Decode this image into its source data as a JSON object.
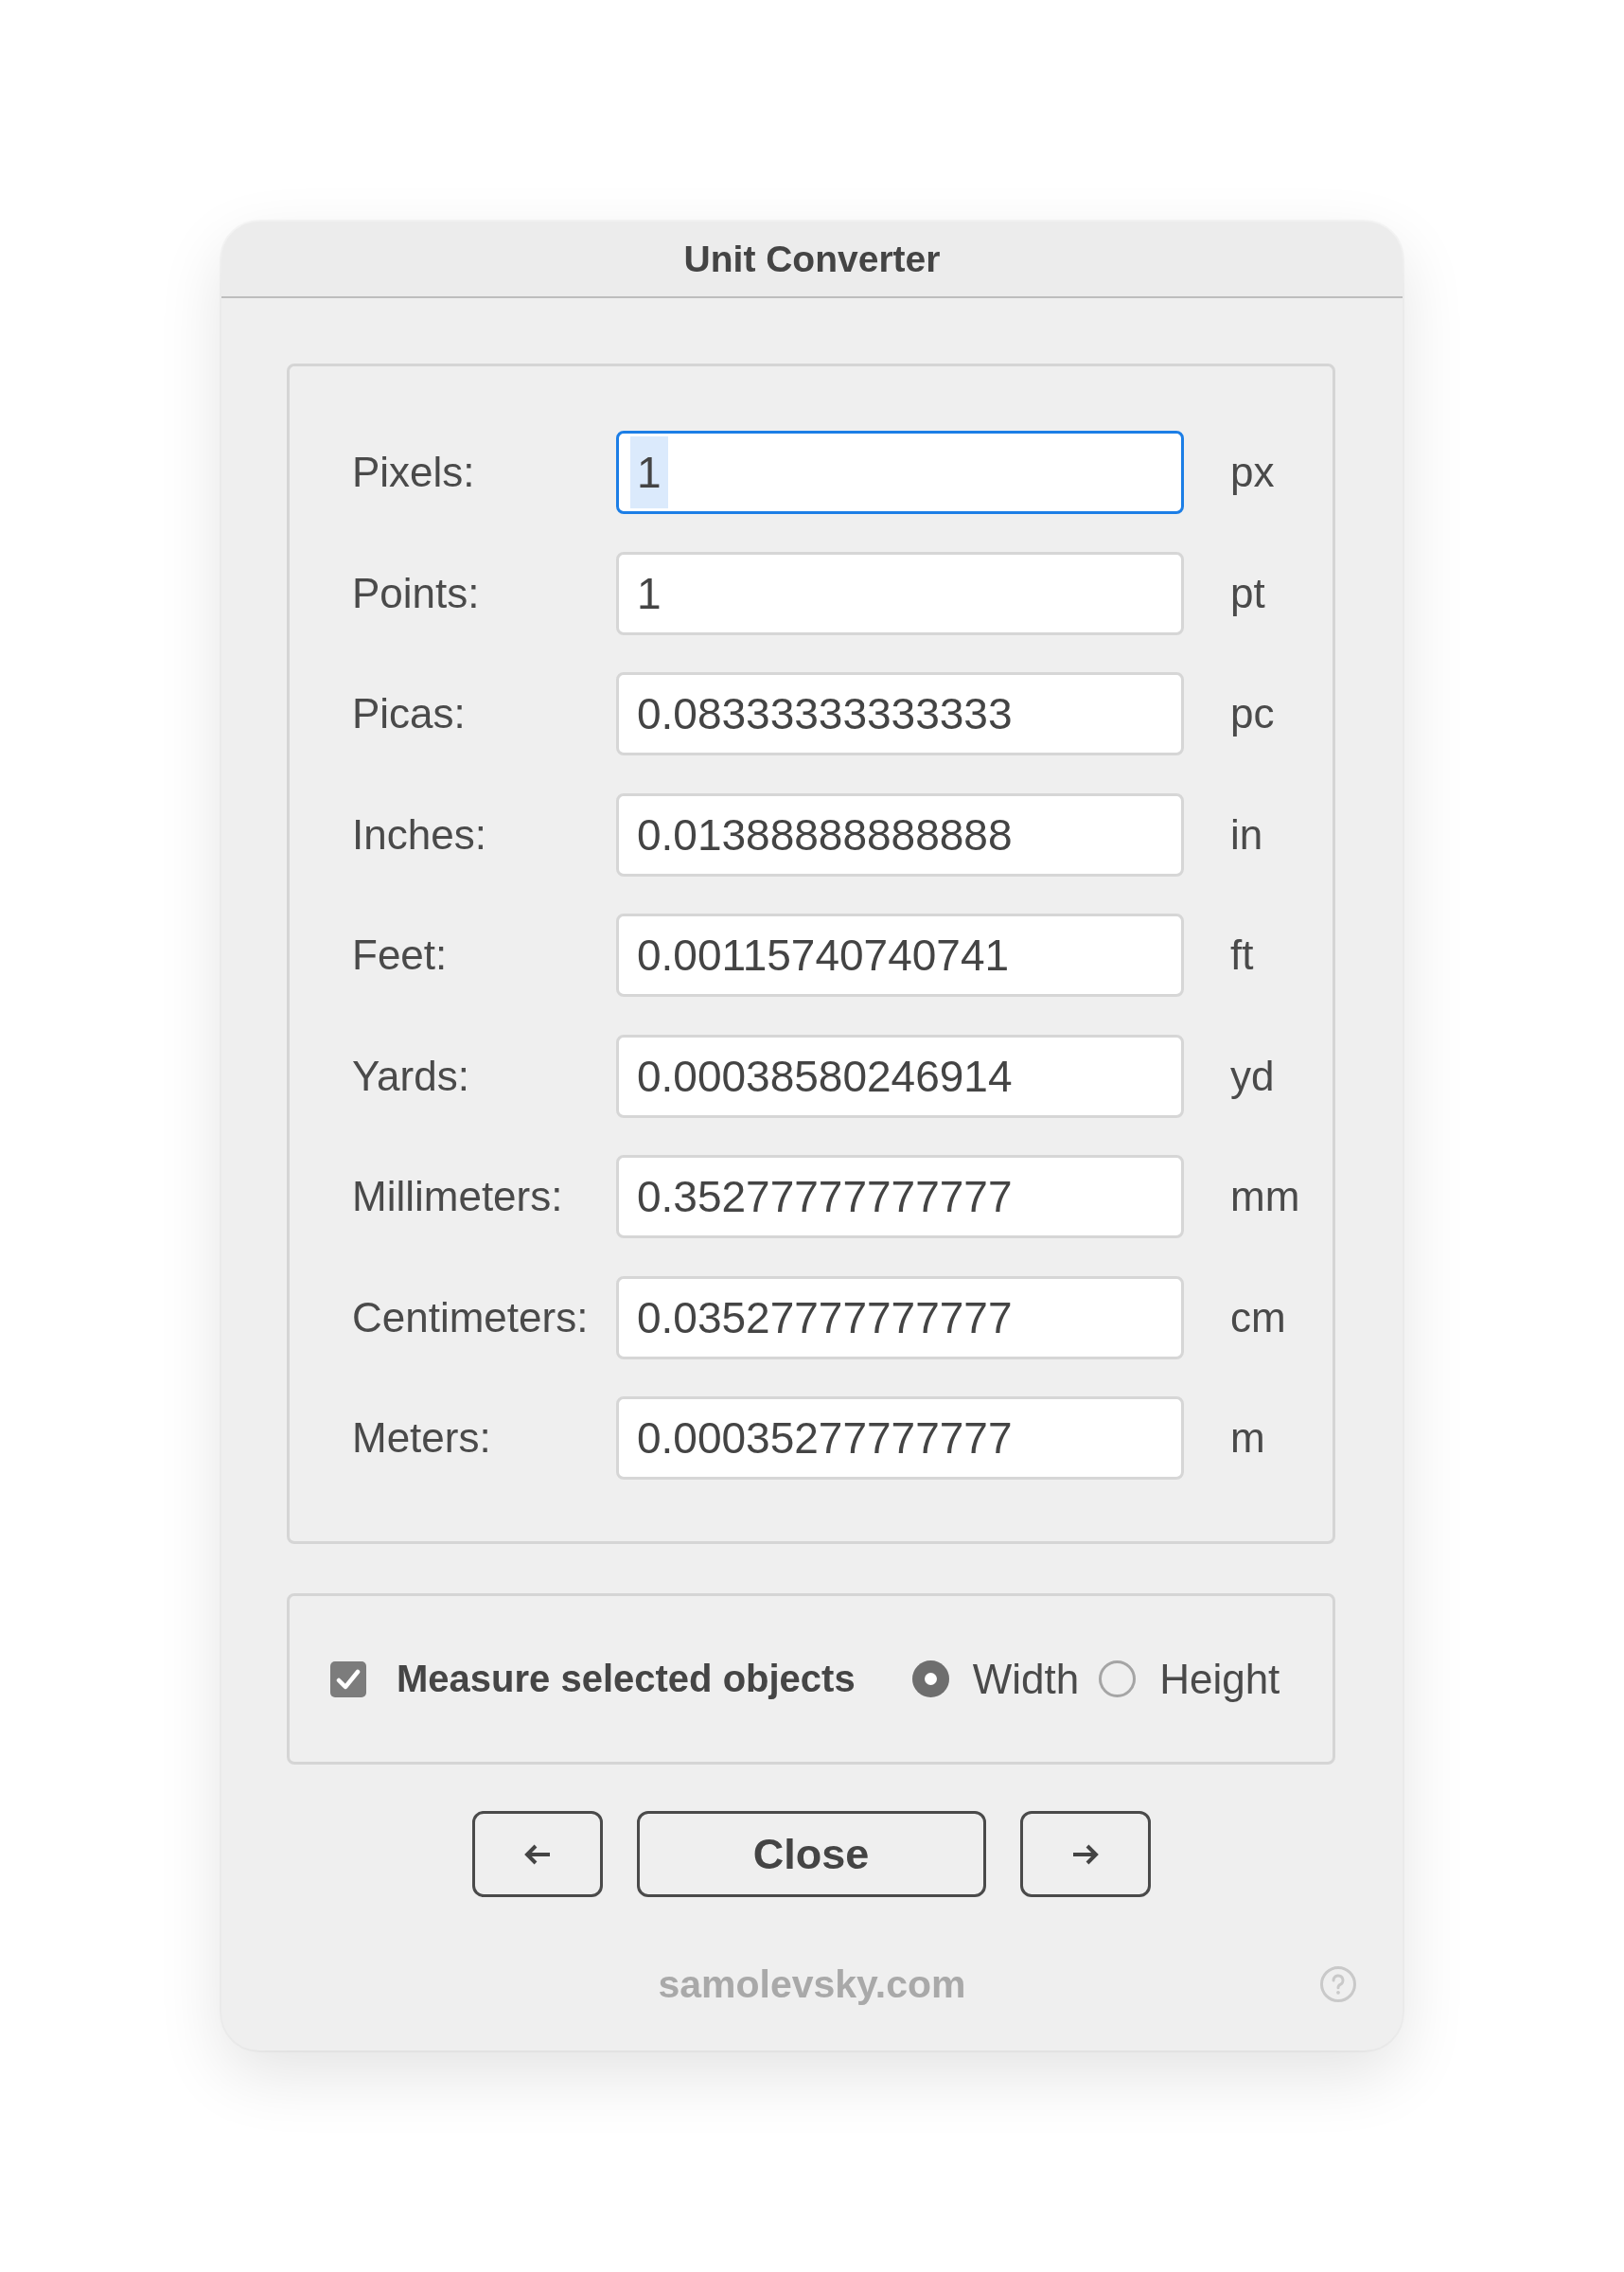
{
  "window": {
    "title": "Unit Converter"
  },
  "units": [
    {
      "label": "Pixels:",
      "value": "1",
      "unit": "px",
      "focused": true
    },
    {
      "label": "Points:",
      "value": "1",
      "unit": "pt",
      "focused": false
    },
    {
      "label": "Picas:",
      "value": "0.08333333333333",
      "unit": "pc",
      "focused": false
    },
    {
      "label": "Inches:",
      "value": "0.01388888888888",
      "unit": "in",
      "focused": false
    },
    {
      "label": "Feet:",
      "value": "0.00115740740741",
      "unit": "ft",
      "focused": false
    },
    {
      "label": "Yards:",
      "value": "0.00038580246914",
      "unit": "yd",
      "focused": false
    },
    {
      "label": "Millimeters:",
      "value": "0.35277777777777",
      "unit": "mm",
      "focused": false
    },
    {
      "label": "Centimeters:",
      "value": "0.03527777777777",
      "unit": "cm",
      "focused": false
    },
    {
      "label": "Meters:",
      "value": "0.00035277777777",
      "unit": "m",
      "focused": false
    }
  ],
  "options": {
    "measure_selected": {
      "label": "Measure selected objects",
      "checked": true
    },
    "dimension": [
      {
        "label": "Width",
        "selected": true
      },
      {
        "label": "Height",
        "selected": false
      }
    ]
  },
  "buttons": [
    {
      "kind": "previous"
    },
    {
      "kind": "close",
      "label": "Close"
    },
    {
      "kind": "next"
    }
  ],
  "footer": {
    "link": "samolevsky.com"
  }
}
